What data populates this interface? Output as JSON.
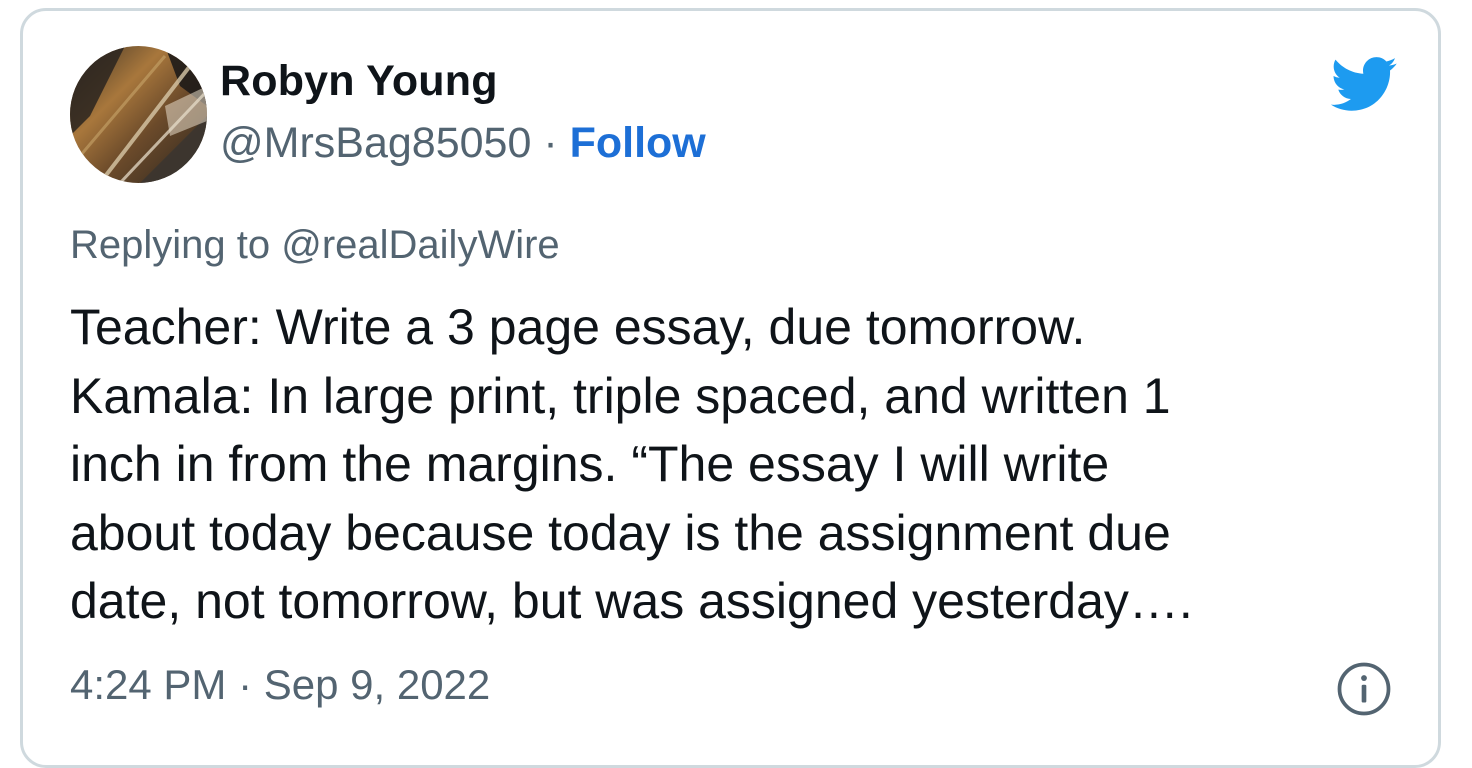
{
  "tweet": {
    "author": {
      "display_name": "Robyn Young",
      "handle": "@MrsBag85050",
      "separator": " · ",
      "follow_label": "Follow",
      "avatar_icon": "avatar-photo"
    },
    "replying": {
      "prefix": "Replying to ",
      "target": "@realDailyWire"
    },
    "text_lines": [
      "Teacher: Write a 3 page essay, due tomorrow.",
      "Kamala: In large print, triple spaced, and written 1",
      "inch in from the margins. “The essay I will write",
      "about today because today is the assignment due",
      "date, not tomorrow, but was assigned yesterday…."
    ],
    "timestamp": "4:24 PM · Sep 9, 2022",
    "icons": {
      "brand": "twitter-bird-icon",
      "info": "info-icon"
    },
    "colors": {
      "brand_blue": "#1d9bf0",
      "follow_blue": "#1d6fd6",
      "text": "#0f1419",
      "secondary": "#536471",
      "border": "#cfd9de"
    }
  }
}
